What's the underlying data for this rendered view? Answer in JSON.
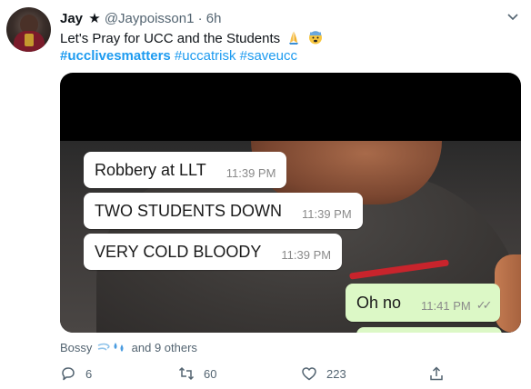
{
  "tweet": {
    "author_name": "Jay",
    "badge": "★",
    "handle": "@Jaypoisson1",
    "separator": "·",
    "time_ago": "6h",
    "text": "Let's Pray for UCC and the Students",
    "emojis": [
      "folded-hands-emoji",
      "anxious-face-emoji"
    ],
    "hashtags": [
      {
        "text": "#ucclivesmatters",
        "bold": true
      },
      {
        "text": "#uccatrisk",
        "bold": false
      },
      {
        "text": "#saveucc",
        "bold": false
      }
    ],
    "media": {
      "messages": [
        {
          "text": "Robbery at LLT",
          "time": "11:39 PM",
          "direction": "in"
        },
        {
          "text": "TWO STUDENTS DOWN",
          "time": "11:39 PM",
          "direction": "in"
        },
        {
          "text": "VERY COLD BLOODY",
          "time": "11:39 PM",
          "direction": "in"
        },
        {
          "text": "Oh no",
          "time": "11:41 PM",
          "direction": "out",
          "ticks": "✓✓"
        }
      ]
    },
    "likers": {
      "name": "Bossy",
      "emoji_icons": [
        "wind-emoji",
        "sweat-droplets-emoji"
      ],
      "suffix": "and 9 others"
    },
    "actions": {
      "reply_count": "6",
      "retweet_count": "60",
      "like_count": "223"
    }
  },
  "colors": {
    "link": "#1d9bf0",
    "muted": "#536471",
    "bubble_out": "#dcf8c6",
    "bubble_in": "#ffffff"
  }
}
